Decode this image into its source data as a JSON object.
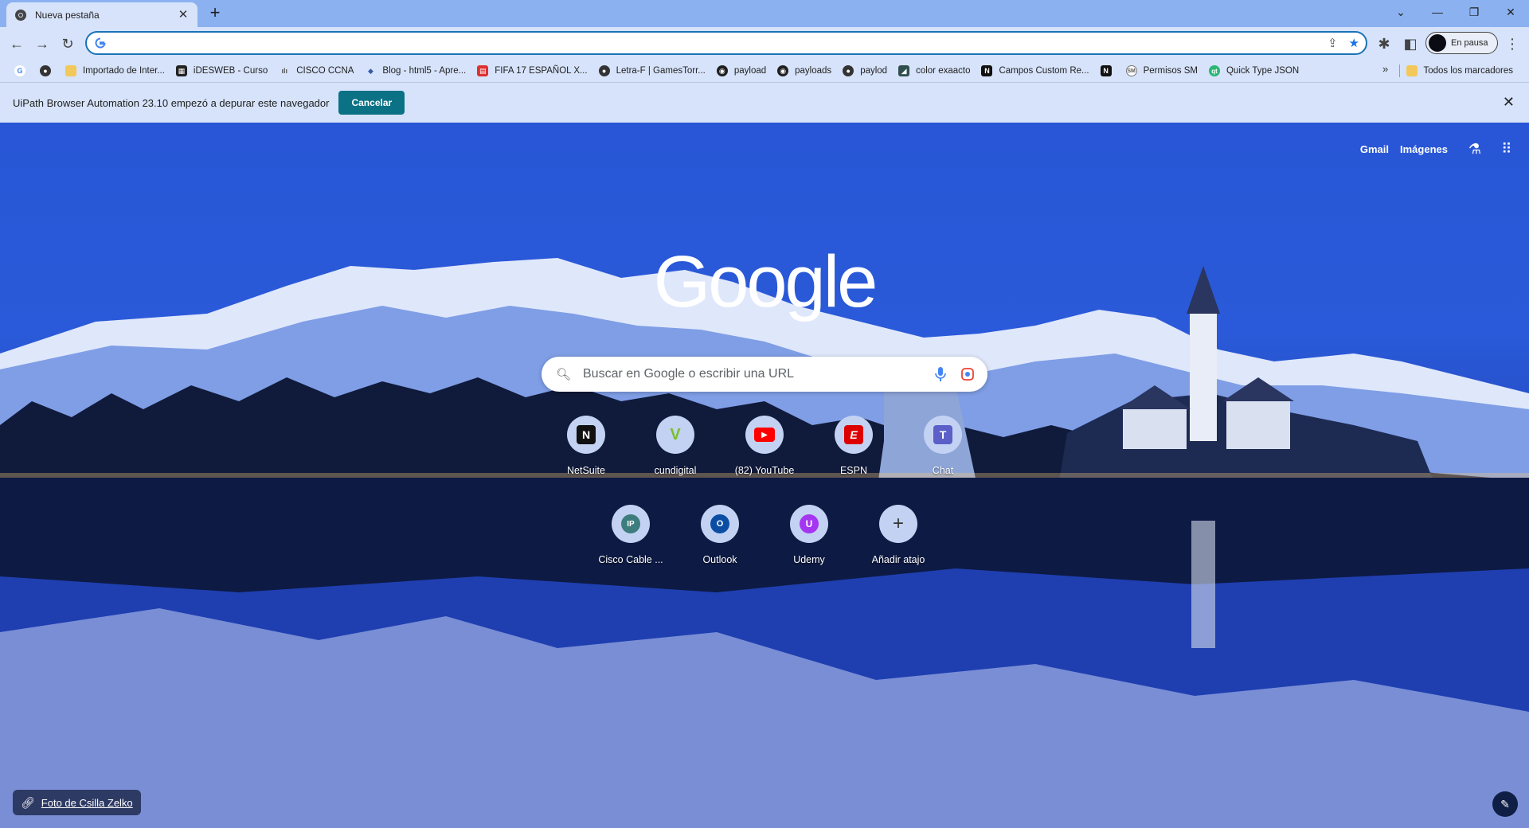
{
  "tab": {
    "title": "Nueva pestaña"
  },
  "toolbar": {
    "omnibox_value": "",
    "profile_label": "En pausa"
  },
  "bookmarks": {
    "items": [
      {
        "label": "Importado de Inter...",
        "icon": "folder-icon"
      },
      {
        "label": "iDESWEB - Curso",
        "icon": "ideasweb-icon"
      },
      {
        "label": "CISCO CCNA",
        "icon": "cisco-icon"
      },
      {
        "label": "Blog - html5 - Apre...",
        "icon": "blog-icon"
      },
      {
        "label": "FIFA 17 ESPAÑOL X...",
        "icon": "fifa-icon"
      },
      {
        "label": "Letra-F | GamesTorr...",
        "icon": "globe-icon"
      },
      {
        "label": "payload",
        "icon": "github-icon"
      },
      {
        "label": "payloads",
        "icon": "github-icon"
      },
      {
        "label": "paylod",
        "icon": "globe-icon"
      },
      {
        "label": "color exaacto",
        "icon": "color-icon"
      },
      {
        "label": "Campos Custom Re...",
        "icon": "netsuite-icon"
      },
      {
        "label": "Permisos SM",
        "icon": "sm-icon"
      },
      {
        "label": "Quick Type JSON",
        "icon": "quicktype-icon"
      }
    ],
    "all_label": "Todos los marcadores"
  },
  "infobar": {
    "message": "UiPath Browser Automation 23.10 empezó a depurar este navegador",
    "cancel_label": "Cancelar"
  },
  "ntp": {
    "links": {
      "gmail": "Gmail",
      "images": "Imágenes"
    },
    "logo": "Google",
    "search_placeholder": "Buscar en Google o escribir una URL",
    "shortcuts": [
      {
        "name": "NetSuite"
      },
      {
        "name": "cundigital"
      },
      {
        "name": "(82) YouTube"
      },
      {
        "name": "ESPN"
      },
      {
        "name": "Chat"
      },
      {
        "name": "Cisco Cable ..."
      },
      {
        "name": "Outlook"
      },
      {
        "name": "Udemy"
      },
      {
        "name": "Añadir atajo"
      }
    ],
    "credit": "Foto de Csilla Zelko"
  }
}
